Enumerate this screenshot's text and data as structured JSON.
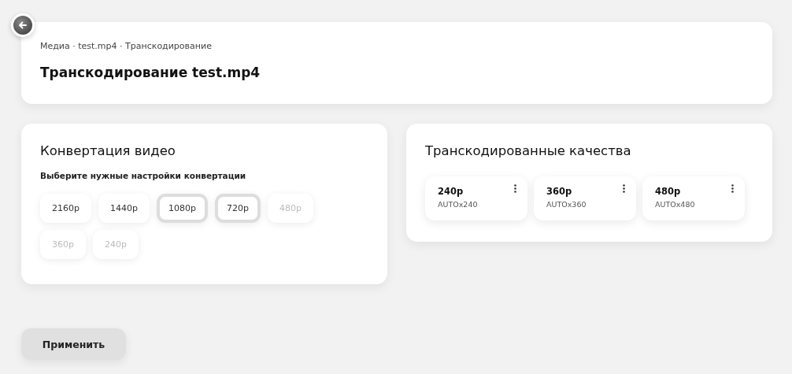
{
  "header": {
    "breadcrumb": "Медиа · test.mp4 · Транскодирование",
    "title": "Транскодирование test.mp4"
  },
  "conversion": {
    "title": "Конвертация видео",
    "subtitle": "Выберите нужные настройки конвертации",
    "options": [
      {
        "label": "2160p",
        "selected": false,
        "disabled": false
      },
      {
        "label": "1440p",
        "selected": false,
        "disabled": false
      },
      {
        "label": "1080p",
        "selected": true,
        "disabled": false
      },
      {
        "label": "720p",
        "selected": true,
        "disabled": false
      },
      {
        "label": "480p",
        "selected": false,
        "disabled": true
      },
      {
        "label": "360p",
        "selected": false,
        "disabled": true
      },
      {
        "label": "240p",
        "selected": false,
        "disabled": true
      }
    ]
  },
  "qualities": {
    "title": "Транскодированные качества",
    "items": [
      {
        "name": "240p",
        "size": "AUTOx240"
      },
      {
        "name": "360p",
        "size": "AUTOx360"
      },
      {
        "name": "480p",
        "size": "AUTOx480"
      }
    ]
  },
  "apply_button": "Применить"
}
